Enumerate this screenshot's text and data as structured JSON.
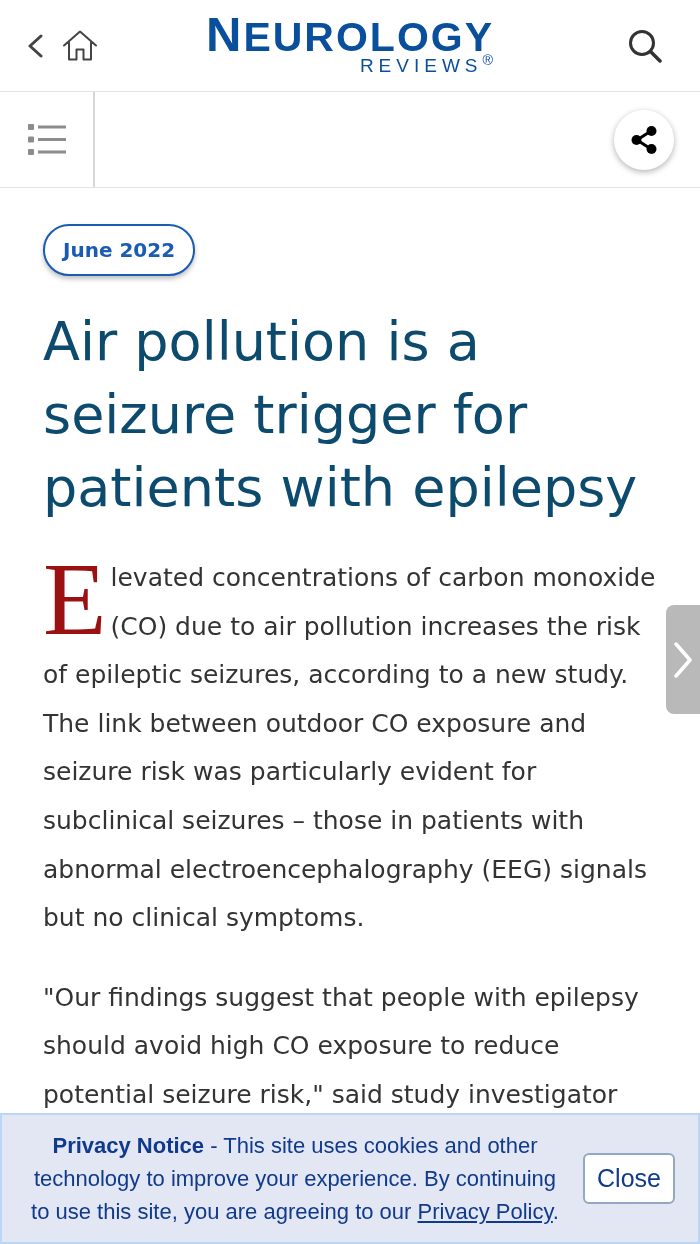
{
  "header": {
    "logo": {
      "wordmark": "NEUROLOGY",
      "tagline": "REVIEWS$^{®}$"
    }
  },
  "article": {
    "issue_badge": "June 2022",
    "title": "Air pollution is a seizure trigger for patients with epilepsy",
    "paragraphs": [
      {
        "text": "Elevated concentrations of carbon monoxide (CO) due to air pollution increases the risk of epileptic seizures, according to a new study. The link between outdoor CO exposure and seizure risk was particularly evident for subclinical seizures – those in patients with abnormal electroencephalography (EEG) signals but no clinical symptoms.",
        "drop_cap": true
      },
      {
        "text": "\"Our findings suggest that people with epilepsy should avoid high CO exposure to reduce potential seizure risk,\" said study investigator",
        "drop_cap": false
      }
    ]
  },
  "privacy_notice": {
    "text": "**Privacy Notice** - This site uses cookies and other technology to improve your experience. By continuing to use this site, you are agreeing to our ",
    "link": "Privacy Policy",
    "text_end": ".",
    "button": "Close"
  }
}
